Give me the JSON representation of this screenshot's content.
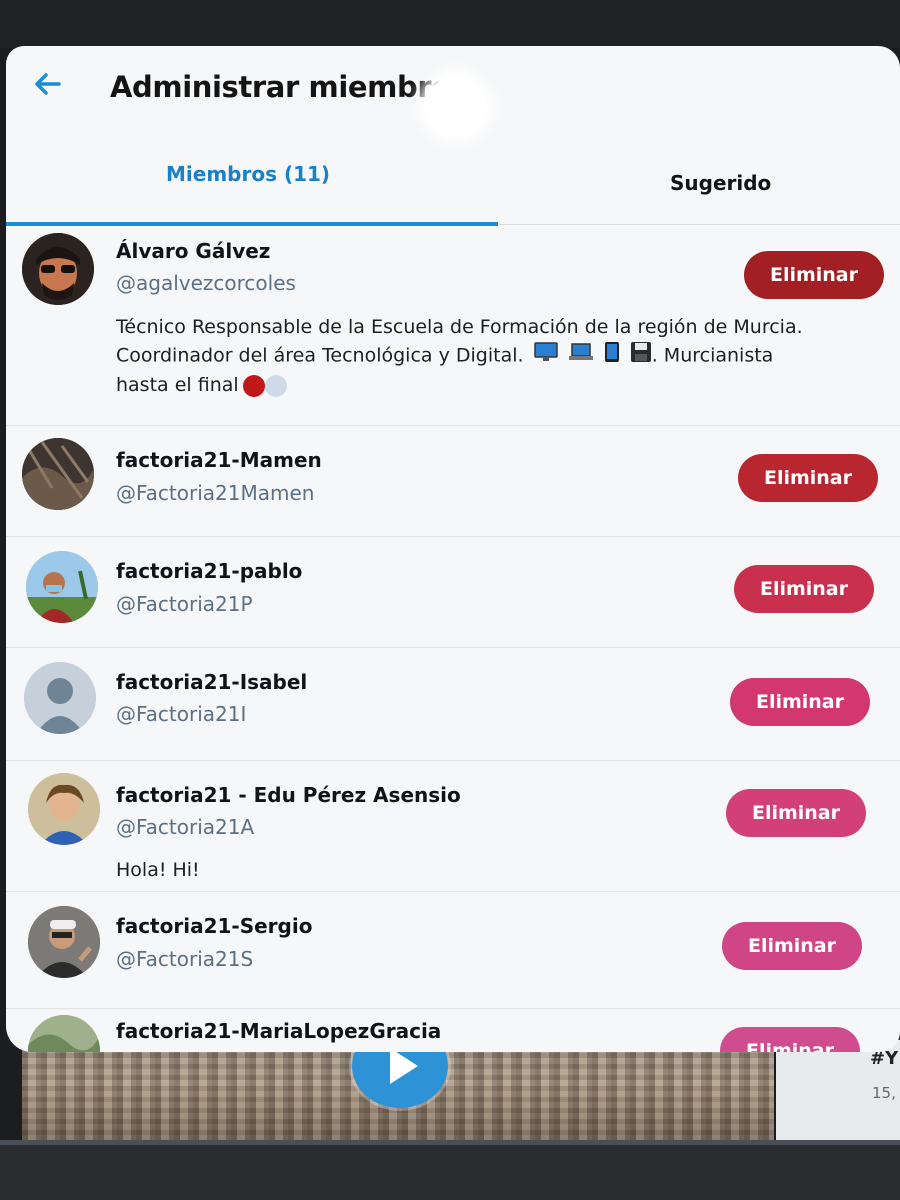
{
  "page": {
    "title": "Administrar miembros",
    "tabs": [
      {
        "label": "Miembros (11)",
        "active": true
      },
      {
        "label": "Sugerido",
        "active": false
      }
    ]
  },
  "members": [
    {
      "name": "Álvaro Gálvez",
      "handle": "@agalvezcorcoles",
      "bio_lines": [
        "Técnico Responsable de la Escuela de Formación de la región de Murcia.",
        "Coordinador del área Tecnológica y Digital.",
        ". Murcianista",
        "hasta el final"
      ],
      "button": "Eliminar"
    },
    {
      "name": "factoria21-Mamen",
      "handle": "@Factoria21Mamen",
      "button": "Eliminar"
    },
    {
      "name": "factoria21-pablo",
      "handle": "@Factoria21P",
      "button": "Eliminar"
    },
    {
      "name": "factoria21-Isabel",
      "handle": "@Factoria21I",
      "button": "Eliminar"
    },
    {
      "name": "factoria21 - Edu Pérez Asensio",
      "handle": "@Factoria21A",
      "bio": "Hola! Hi!",
      "button": "Eliminar"
    },
    {
      "name": "factoria21-Sergio",
      "handle": "@Factoria21S",
      "button": "Eliminar"
    },
    {
      "name": "factoria21-MariaLopezGracia",
      "button": "Eliminar"
    }
  ],
  "background": {
    "side_tag": "#Y",
    "side_count": "15,"
  },
  "colors": {
    "accent": "#1d8cd8",
    "button_red": "#b5232e",
    "button_pink": "#d83c75"
  }
}
